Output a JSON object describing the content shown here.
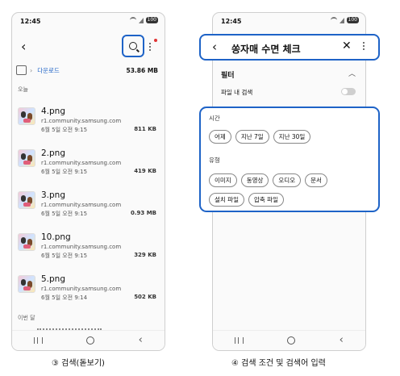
{
  "left_phone": {
    "status_time": "12:45",
    "battery": "100",
    "breadcrumb_label": "다운로드",
    "storage": "53.86 MB",
    "section_today": "오늘",
    "files": [
      {
        "name": "4.png",
        "source": "r1.community.samsung.com",
        "date": "6월 5일 오전 9:15",
        "size": "811 KB"
      },
      {
        "name": "2.png",
        "source": "r1.community.samsung.com",
        "date": "6월 5일 오전 9:15",
        "size": "419 KB"
      },
      {
        "name": "3.png",
        "source": "r1.community.samsung.com",
        "date": "6월 5일 오전 9:15",
        "size": "0.93 MB"
      },
      {
        "name": "10.png",
        "source": "r1.community.samsung.com",
        "date": "6월 5일 오전 9:15",
        "size": "329 KB"
      },
      {
        "name": "5.png",
        "source": "r1.community.samsung.com",
        "date": "6월 5일 오전 9:14",
        "size": "502 KB"
      }
    ],
    "section_month": "이번 달",
    "caption": "③ 검색(돋보기)"
  },
  "right_phone": {
    "status_time": "12:45",
    "battery": "100",
    "search_query": "쏭자매 수면 체크",
    "filter_title": "필터",
    "in_file_search_label": "파일 내 검색",
    "time_group_label": "시간",
    "time_chips": [
      "어제",
      "지난 7일",
      "지난 30일"
    ],
    "type_group_label": "유형",
    "type_chips_row1": [
      "이미지",
      "동영상",
      "오디오",
      "문서"
    ],
    "type_chips_row2": [
      "설치 파일",
      "압축 파일"
    ],
    "caption": "④ 검색 조건 및 검색어 입력"
  },
  "colors": {
    "accent_blue": "#1e63c7",
    "notify_red": "#e03434"
  }
}
